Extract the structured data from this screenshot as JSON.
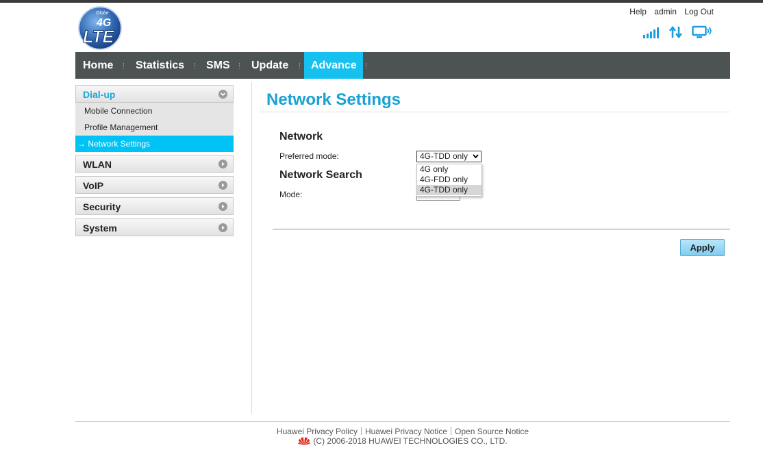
{
  "header": {
    "logo_small": "Globe",
    "logo_4g": "4G",
    "logo_lte": "LTE",
    "links": [
      "Help",
      "admin",
      "Log Out"
    ]
  },
  "nav": {
    "items": [
      "Home",
      "Statistics",
      "SMS",
      "Update",
      "Advance"
    ],
    "active": "Advance"
  },
  "sidebar": {
    "dialup": {
      "label": "Dial-up",
      "subitems": [
        "Mobile Connection",
        "Profile Management",
        "→ Network Settings"
      ]
    },
    "sections": [
      "WLAN",
      "VoIP",
      "Security",
      "System"
    ]
  },
  "main": {
    "title": "Network Settings",
    "network_heading": "Network",
    "preferred_mode_label": "Preferred mode:",
    "preferred_mode_value": "4G-TDD only",
    "preferred_mode_options": [
      "4G only",
      "4G-FDD only",
      "4G-TDD only"
    ],
    "network_search_heading": "Network Search",
    "mode_label": "Mode:",
    "apply_label": "Apply"
  },
  "footer": {
    "links": [
      "Huawei Privacy Policy",
      "Huawei Privacy Notice",
      "Open Source Notice"
    ],
    "copyright": "(C) 2006-2018 HUAWEI TECHNOLOGIES CO., LTD."
  },
  "colors": {
    "accent": "#16c1ef",
    "title": "#19a1d3",
    "navbar": "#4d5253",
    "brand_logo": "#2f66b1",
    "huawei_red": "#e2231a"
  }
}
